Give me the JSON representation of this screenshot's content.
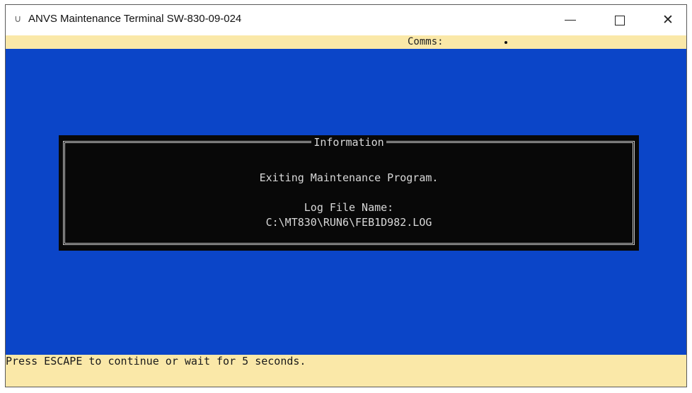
{
  "window": {
    "title": "ANVS Maintenance Terminal SW-830-09-024",
    "app_icon": "power-icon"
  },
  "status": {
    "comms_label": "Comms:",
    "comms_indicator": "dot"
  },
  "dialog": {
    "title": "Information",
    "message": "Exiting Maintenance Program.",
    "log_label": "Log File Name:",
    "log_path": "C:\\MT830\\RUN6\\FEB1D982.LOG"
  },
  "prompt": {
    "text": "Press ESCAPE to continue or wait for 5 seconds."
  },
  "colors": {
    "terminal_bg": "#0b45c8",
    "status_bg": "#fae8a8",
    "dialog_bg": "#080808",
    "dialog_text": "#d8d8d8"
  }
}
